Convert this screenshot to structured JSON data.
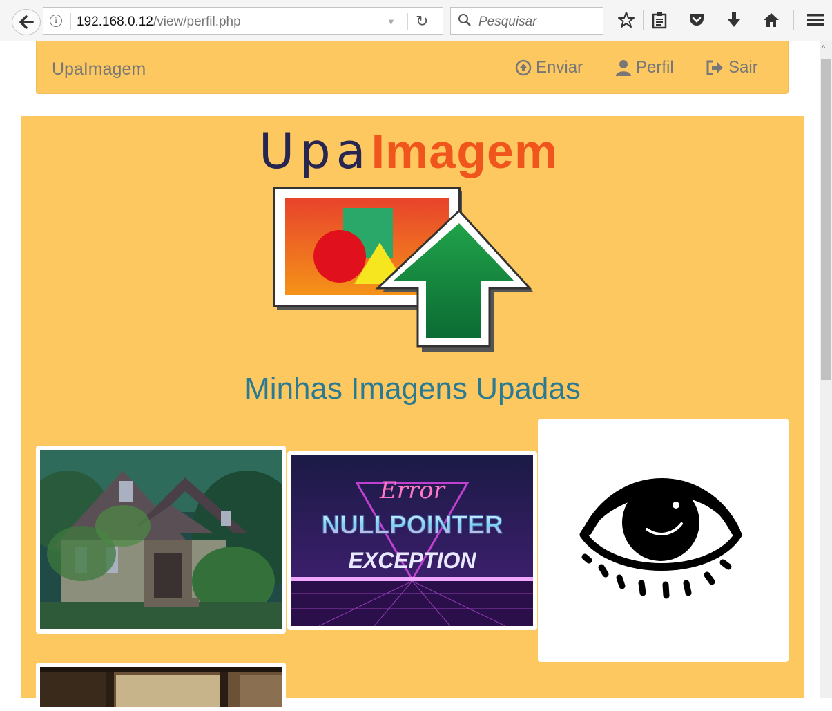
{
  "browser": {
    "url_host": "192.168.0.12",
    "url_path": "/view/perfil.php",
    "search_placeholder": "Pesquisar",
    "icons": [
      "back-arrow-icon",
      "info-icon",
      "dropdown-icon",
      "reload-icon",
      "search-icon",
      "bookmark-star-icon",
      "reader-list-icon",
      "pocket-icon",
      "download-icon",
      "home-icon",
      "menu-icon"
    ]
  },
  "navbar": {
    "brand": "UpaImagem",
    "items": [
      {
        "label": "Enviar",
        "icon": "upload-circle-icon"
      },
      {
        "label": "Perfil",
        "icon": "user-icon"
      },
      {
        "label": "Sair",
        "icon": "logout-icon"
      }
    ]
  },
  "logo": {
    "part1": "Upa",
    "part2": "Imagem"
  },
  "main": {
    "heading": "Minhas Imagens Upadas",
    "images": [
      {
        "name": "house-image"
      },
      {
        "name": "nullpointer-image",
        "script_text": "Error",
        "line1": "NULLPOINTER",
        "line2": "EXCEPTION"
      },
      {
        "name": "eye-drawing-image"
      },
      {
        "name": "partial-image"
      }
    ]
  },
  "colors": {
    "panel": "#fec861",
    "heading": "#2a7a92",
    "logo_dark": "#262650",
    "logo_orange": "#f0551c"
  }
}
